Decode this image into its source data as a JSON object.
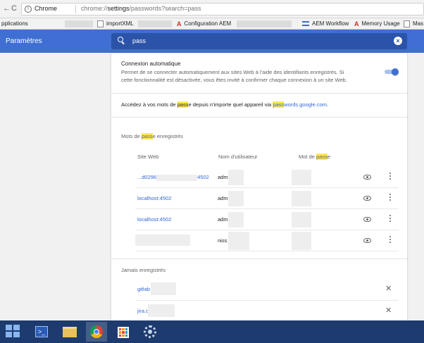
{
  "browser": {
    "back_glyph": "←",
    "reload_glyph": "C",
    "site_chip": "Chrome",
    "url_prefix": "chrome://",
    "url_host": "settings",
    "url_path": "/passwords?search=pass"
  },
  "bookmarks": [
    {
      "label": "pplications",
      "icon": "apps-icon"
    },
    {
      "label": "importXML",
      "icon": "page-icon"
    },
    {
      "label": "Configuration AEM",
      "icon": "adobe-icon"
    },
    {
      "label": "AEM Workflow",
      "icon": "workflow-icon"
    },
    {
      "label": "Memory Usage",
      "icon": "adobe-icon"
    },
    {
      "label": "Mas",
      "icon": "page-icon"
    }
  ],
  "header": {
    "title": "Paramètres",
    "search_value": "pass",
    "clear_glyph": "×"
  },
  "autologin": {
    "title": "Connexion automatique",
    "description": "Permet de se connecter automatiquement aux sites Web à l'aide des identifiants enregistrés. Si cette fonctionnalité est désactivée, vous êtes invité à confirmer chaque connexion à un site Web.",
    "enabled": true
  },
  "access": {
    "before": "Accédez à vos mots de ",
    "highlight": "pass",
    "middle": "e depuis n'importe quel appareil via ",
    "link_highlight": "pass",
    "link_rest": "words.google.com",
    "end": "."
  },
  "saved": {
    "title_before": "Mots de ",
    "title_highlight": "pass",
    "title_after": "e enregistrés",
    "columns": {
      "site": "Site Web",
      "user": "Nom d'utilisateur",
      "password_before": "Mot de ",
      "password_highlight": "pass",
      "password_after": "e"
    },
    "rows": [
      {
        "site_start": "...d0296",
        "site_end": "4502",
        "user": "adm"
      },
      {
        "site_start": "localhost:4502",
        "site_end": "",
        "user": "adm"
      },
      {
        "site_start": "localhost:4502",
        "site_end": "",
        "user": "adm"
      },
      {
        "site_start": "",
        "site_end": "",
        "user": "niss"
      }
    ]
  },
  "never": {
    "title": "Jamais enregistrés",
    "rows": [
      {
        "site": "gitlab"
      },
      {
        "site": "jira.d"
      }
    ],
    "remove_glyph": "✕"
  },
  "taskbar": {
    "powershell_glyph": ">_"
  }
}
